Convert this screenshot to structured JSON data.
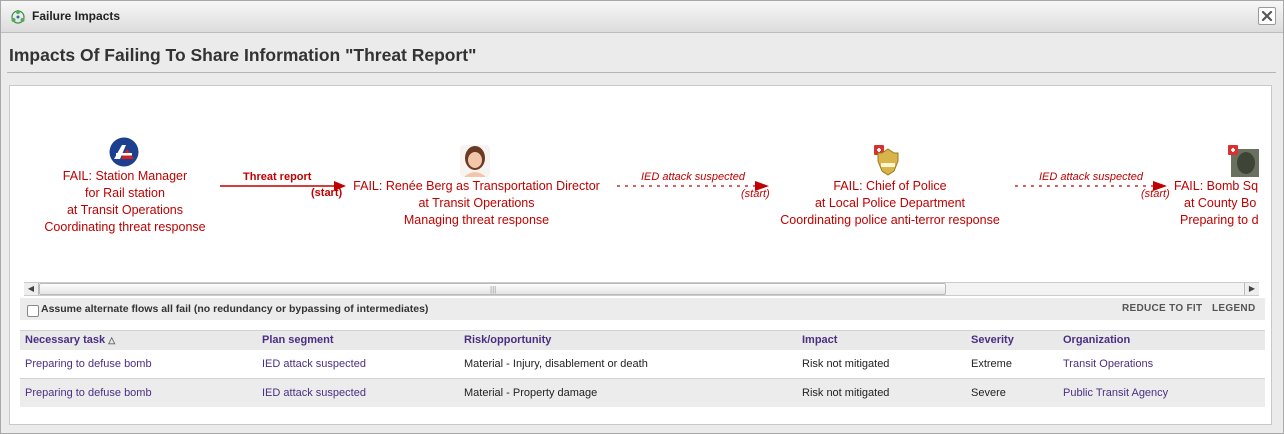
{
  "window": {
    "title": "Failure Impacts"
  },
  "page": {
    "title": "Impacts Of Failing To Share Information \"Threat Report\""
  },
  "graph": {
    "nodes": [
      {
        "lines": [
          "FAIL: Station Manager",
          "for Rail station",
          "at Transit Operations",
          "Coordinating threat response"
        ],
        "icon": "rail-agency-logo-icon"
      },
      {
        "lines": [
          "FAIL: Renée Berg as Transportation Director",
          "at Transit Operations",
          "Managing threat response"
        ],
        "icon": "person-photo-icon"
      },
      {
        "lines": [
          "FAIL: Chief of Police",
          "at Local Police Department",
          "Coordinating police anti-terror response"
        ],
        "icon": "police-badge-icon"
      },
      {
        "lines": [
          "FAIL: Bomb Sq",
          "at County Bo",
          "Preparing to d"
        ],
        "icon": "bomb-squad-photo-icon"
      }
    ],
    "edges": [
      {
        "label": "Threat report",
        "sublabel": "(start)",
        "style": "solid"
      },
      {
        "label": "IED attack suspected",
        "sublabel": "(start)",
        "style": "dashed"
      },
      {
        "label": "IED attack suspected",
        "sublabel": "(start)",
        "style": "dashed"
      }
    ],
    "edge_color": "#c00000"
  },
  "options": {
    "alternate_flows_label": "Assume alternate flows all fail (no redundancy or bypassing of intermediates)",
    "reduce_to_fit": "REDUCE TO FIT",
    "legend": "LEGEND"
  },
  "table": {
    "headers": [
      "Necessary task",
      "Plan segment",
      "Risk/opportunity",
      "Impact",
      "Severity",
      "Organization"
    ],
    "sort_indicator": "△",
    "rows": [
      [
        "Preparing to defuse bomb",
        "IED attack suspected",
        "Material - Injury, disablement or death",
        "Risk not mitigated",
        "Extreme",
        "Transit Operations"
      ],
      [
        "Preparing to defuse bomb",
        "IED attack suspected",
        "Material - Property damage",
        "Risk not mitigated",
        "Severe",
        "Public Transit Agency"
      ]
    ]
  }
}
